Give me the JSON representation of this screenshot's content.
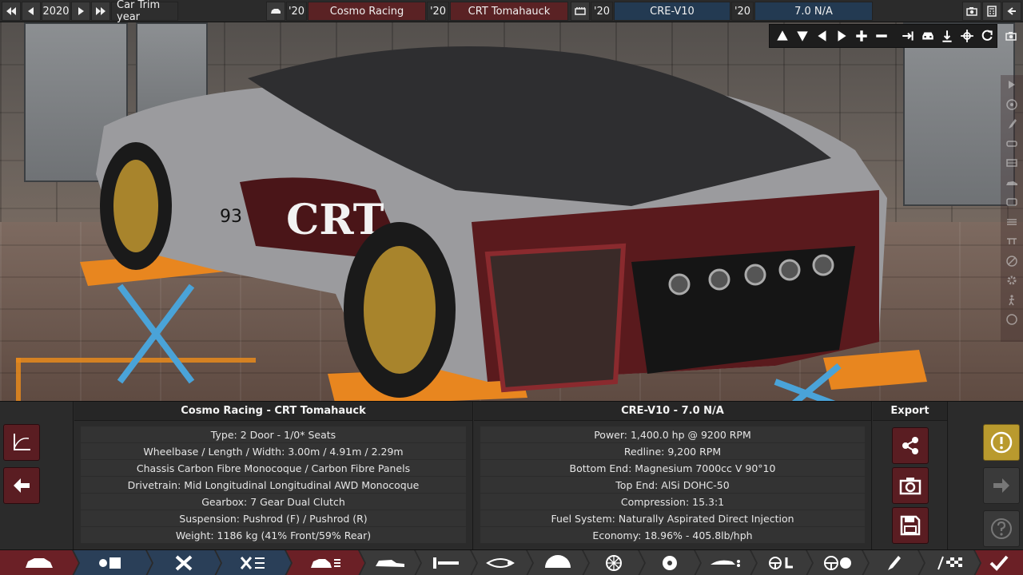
{
  "topbar": {
    "year": "2020",
    "year_label": "Car Trim year",
    "car_model_year": "'20",
    "car_model": "Cosmo Racing",
    "trim_year": "'20",
    "trim": "CRT Tomahauck",
    "engine_family_year": "'20",
    "engine_family": "CRE-V10",
    "variant_year": "'20",
    "variant": "7.0 N/A"
  },
  "car_panel": {
    "title": "Cosmo Racing - CRT Tomahauck",
    "rows": [
      "Type: 2 Door - 1/0* Seats",
      "Wheelbase / Length / Width: 3.00m / 4.91m / 2.29m",
      "Chassis Carbon Fibre Monocoque / Carbon Fibre Panels",
      "Drivetrain: Mid Longitudinal Longitudinal AWD Monocoque",
      "Gearbox: 7 Gear Dual Clutch",
      "Suspension: Pushrod (F) / Pushrod (R)",
      "Weight: 1186 kg (41% Front/59% Rear)"
    ]
  },
  "engine_panel": {
    "title": "CRE-V10 - 7.0 N/A",
    "rows": [
      "Power: 1,400.0 hp @ 9200 RPM",
      "Redline:  9,200 RPM",
      "Bottom End: Magnesium 7000cc V 90°10",
      "Top End: AlSi DOHC-50",
      "Compression: 15.3:1",
      "Fuel System: Naturally Aspirated Direct Injection",
      "Economy: 18.96% - 405.8lb/hph"
    ]
  },
  "export_panel": {
    "title": "Export"
  },
  "colors": {
    "accent_red": "#5a1d22",
    "accent_blue": "#233a52",
    "warning_gold": "#b99a2e"
  }
}
